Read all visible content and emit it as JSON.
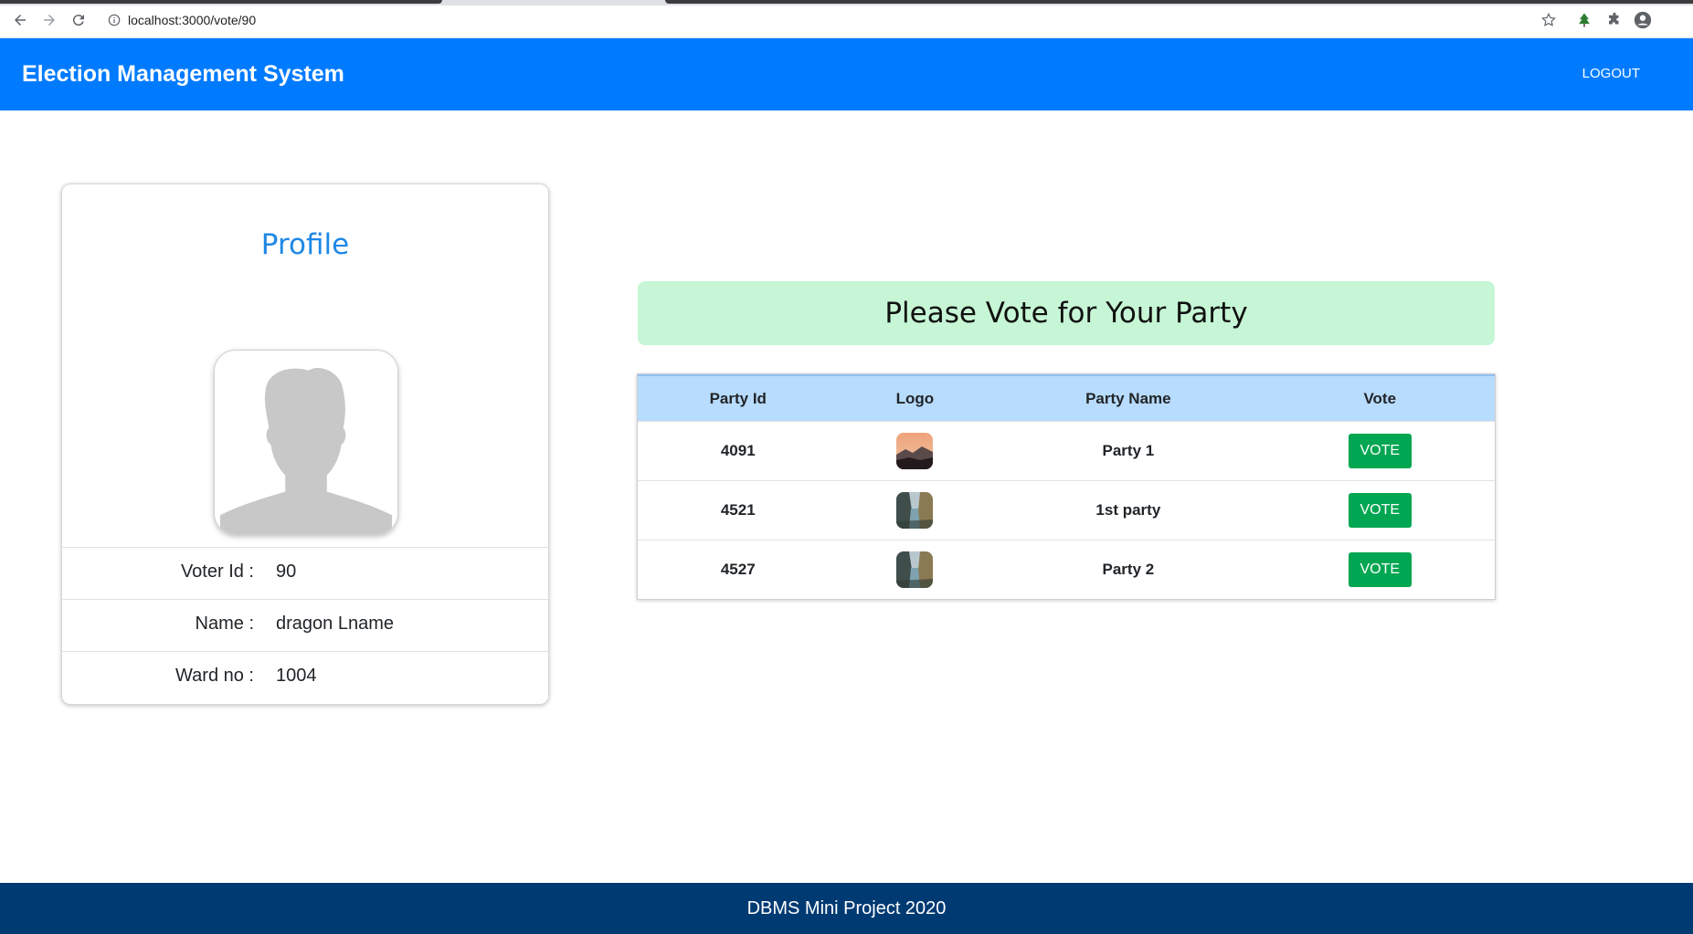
{
  "browser": {
    "url": "localhost:3000/vote/90",
    "icons": [
      "back-arrow-icon",
      "forward-arrow-icon",
      "reload-icon",
      "info-icon",
      "star-icon",
      "extension-icon",
      "puzzle-icon",
      "account-icon"
    ]
  },
  "navbar": {
    "brand": "Election Management System",
    "logout_label": "LOGOUT",
    "bg_color": "#007bff"
  },
  "profile": {
    "title": "Profile",
    "avatar_icon": "user-silhouette-icon",
    "rows": [
      {
        "label": "Voter Id :",
        "value": "90"
      },
      {
        "label": "Name :",
        "value": "dragon Lname"
      },
      {
        "label": "Ward no :",
        "value": "1004"
      }
    ]
  },
  "vote": {
    "banner": "Please Vote for Your Party",
    "banner_color": "#c6f6d5",
    "columns": [
      "Party Id",
      "Logo",
      "Party Name",
      "Vote"
    ],
    "parties": [
      {
        "id": "4091",
        "name": "Party 1",
        "logo": "sunset-landscape-icon",
        "vote_label": "VOTE"
      },
      {
        "id": "4521",
        "name": "1st party",
        "logo": "valley-landscape-icon",
        "vote_label": "VOTE"
      },
      {
        "id": "4527",
        "name": "Party 2",
        "logo": "valley-landscape-icon",
        "vote_label": "VOTE"
      }
    ],
    "button_color": "#00a651"
  },
  "footer": {
    "text": "DBMS Mini Project 2020",
    "bg_color": "#003a73"
  }
}
